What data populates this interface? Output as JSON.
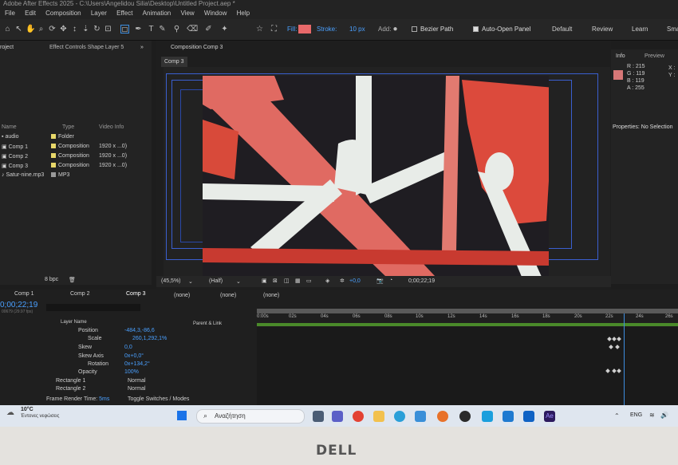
{
  "window": {
    "title": "Adobe After Effects 2025 - C:\\Users\\Angelidou Silia\\Desktop\\Untitled Project.aep *"
  },
  "menu": [
    "File",
    "Edit",
    "Composition",
    "Layer",
    "Effect",
    "Animation",
    "View",
    "Window",
    "Help"
  ],
  "toolbar": {
    "fill_label": "Fill:",
    "stroke_label": "Stroke:",
    "stroke_width": "10 px",
    "add_label": "Add:",
    "bezier_label": "Bezier Path",
    "auto_open_label": "Auto-Open Panel",
    "fill_color": "#e8696a",
    "stroke_color": "#e8696a"
  },
  "workspaces": [
    "Default",
    "Review",
    "Learn",
    "Smal"
  ],
  "project_panel": {
    "tab_project": "roject",
    "tab_effect": "Effect Controls Shape Layer 5",
    "columns": {
      "name": "Name",
      "type": "Type",
      "info": "Video Info"
    },
    "items": [
      {
        "name": "audio",
        "type": "Folder",
        "info": "",
        "color": "#e8d86a"
      },
      {
        "name": "Comp 1",
        "type": "Composition",
        "info": "1920 x ...0)",
        "color": "#e8d86a"
      },
      {
        "name": "Comp 2",
        "type": "Composition",
        "info": "1920 x ...0)",
        "color": "#e8d86a"
      },
      {
        "name": "Comp 3",
        "type": "Composition",
        "info": "1920 x ...0)",
        "color": "#e8d86a"
      },
      {
        "name": "Satur-nine.mp3",
        "type": "MP3",
        "info": "",
        "color": "#9a9a9a"
      }
    ],
    "bpc": "8 bpc"
  },
  "composition_panel": {
    "tab_label": "Composition Comp 3",
    "sub_tab": "Comp 3",
    "zoom": "(45,5%)",
    "quality": "(Half)",
    "exposure": "+0,0",
    "timecode": "0;00;22;19"
  },
  "info_panel": {
    "tab_info": "Info",
    "tab_preview": "Preview",
    "r": "R : 215",
    "g": "G : 119",
    "b": "B : 119",
    "a": "A : 255",
    "x": "X :",
    "y": "Y :",
    "swatch": "#d77777",
    "properties_title": "Properties: No Selection"
  },
  "timeline": {
    "tabs": [
      "Comp 1",
      "Comp 2",
      "Comp 3"
    ],
    "parent_tabs": [
      "(none)",
      "(none)",
      "(none)"
    ],
    "timecode": "0;00;22;19",
    "fps": "00679 (29.97 fps)",
    "layer_name_header": "Layer Name",
    "parent_header": "Parent & Link",
    "properties": [
      {
        "name": "Position",
        "value": "-484,3,-86,6"
      },
      {
        "name": "Scale",
        "value": "260,1,292,1%"
      },
      {
        "name": "Skew",
        "value": "0,0"
      },
      {
        "name": "Skew Axis",
        "value": "0x+0,0°"
      },
      {
        "name": "Rotation",
        "value": "0x+134,2°"
      },
      {
        "name": "Opacity",
        "value": "100%"
      }
    ],
    "sublayers": [
      {
        "name": "Rectangle 1",
        "mode": "Normal"
      },
      {
        "name": "Rectangle 2",
        "mode": "Normal"
      }
    ],
    "frame_render_label": "Frame Render Time:",
    "frame_render_value": "5ms",
    "toggle_label": "Toggle Switches / Modes",
    "ruler": [
      "0:00s",
      "02s",
      "04s",
      "06s",
      "08s",
      "10s",
      "12s",
      "14s",
      "16s",
      "18s",
      "20s",
      "22s",
      "24s",
      "26s"
    ],
    "playhead_fraction": 0.872
  },
  "taskbar": {
    "weather_temp": "10°C",
    "weather_text": "Έντονες νεφώσεις",
    "search_placeholder": "Αναζήτηση",
    "language": "ENG"
  },
  "monitor": {
    "brand": "DELL"
  }
}
